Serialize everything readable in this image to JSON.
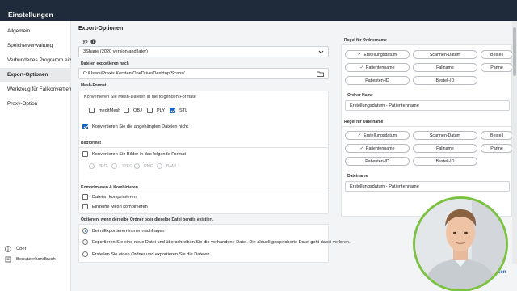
{
  "window": {
    "title": "Einstellungen"
  },
  "sidebar": {
    "items": [
      {
        "label": "Allgemein"
      },
      {
        "label": "Speicherverwaltung"
      },
      {
        "label": "Verbundenes Programm eins"
      },
      {
        "label": "Export-Optionen"
      },
      {
        "label": "Werkzeug für Fallkonvertierung"
      },
      {
        "label": "Proxy-Option"
      }
    ],
    "footer": [
      {
        "label": "Über"
      },
      {
        "label": "Benutzerhandbuch"
      }
    ]
  },
  "export": {
    "heading": "Export-Optionen",
    "type_label": "Typ",
    "type_value": "3Shape (2020 version and later)",
    "path_label": "Dateien exportieren nach",
    "path_value": "C:/Users/Praxis Kersten/OneDrive/Desktop/Scans/",
    "mesh": {
      "label": "Mesh-Format",
      "instruction": "Konvertieren Sie Mesh-Dateien in die folgenden Formate",
      "options": [
        {
          "label": "meditMesh",
          "checked": false
        },
        {
          "label": "OBJ",
          "checked": false
        },
        {
          "label": "PLY",
          "checked": false
        },
        {
          "label": "STL",
          "checked": true
        }
      ],
      "attached_label": "Konvertieren Sie die angehängten Dateien nicht",
      "attached_checked": true
    },
    "image": {
      "label": "Bildformat",
      "convert_label": "Konvertieren Sie Bilder in das folgende Format",
      "formats": [
        "JPG",
        "JPEG",
        "PNG",
        "BMP"
      ]
    },
    "compress": {
      "label": "Komprimieren & Kombinieren",
      "options": [
        {
          "label": "Dateien komprimieren"
        },
        {
          "label": "Einzelne Mesh kombinieren"
        }
      ]
    },
    "conflict": {
      "label": "Optionen, wenn derselbe Ordner oder dieselbe Datei bereits existiert.",
      "options": [
        {
          "label": "Beim Exportieren immer nachfragen",
          "selected": true
        },
        {
          "label": "Exportieren Sie eine neue Datei und überschreiben Sie die vorhandene Datei. Die aktuell gespeicherte Datei geht dabei verloren.",
          "selected": false
        },
        {
          "label": "Erstellen Sie einen Ordner und exportieren Sie die Dateien",
          "selected": false
        }
      ]
    }
  },
  "folder_rule": {
    "label": "Regel für Ordnername",
    "chips_row1": [
      {
        "label": "Erstellungsdatum",
        "checked": true
      },
      {
        "label": "Scannen-Datum"
      },
      {
        "label": "Bestell"
      }
    ],
    "chips_row2": [
      {
        "label": "Patientenname",
        "checked": true
      },
      {
        "label": "Fallname"
      },
      {
        "label": "Partne"
      }
    ],
    "chips_row3": [
      {
        "label": "Patienten-ID"
      },
      {
        "label": "Bestell-ID"
      }
    ],
    "name_label": "Ordner Name",
    "name_value": "Erstellungsdatum - Patientenname"
  },
  "file_rule": {
    "label": "Regel für Dateiname",
    "chips_row1": [
      {
        "label": "Erstellungsdatum",
        "checked": true
      },
      {
        "label": "Scannen-Datum"
      },
      {
        "label": "Bestell"
      }
    ],
    "chips_row2": [
      {
        "label": "Patientenname",
        "checked": true
      },
      {
        "label": "Fallname"
      },
      {
        "label": "Partne"
      }
    ],
    "chips_row3": [
      {
        "label": "Patienten-ID"
      },
      {
        "label": "Bestell-ID"
      }
    ],
    "name_label": "Dateiname",
    "name_value": "Erstellungsdatum - Patientenname"
  },
  "footer": {
    "close_label": "Schließen"
  },
  "icons": {
    "info": "info-icon",
    "chevron": "chevron-down-icon",
    "folder": "folder-icon",
    "check": "check-icon"
  },
  "colors": {
    "accent": "#1a62c4",
    "titlebar": "#1f2b3a",
    "webcam_ring": "#7cc242"
  }
}
